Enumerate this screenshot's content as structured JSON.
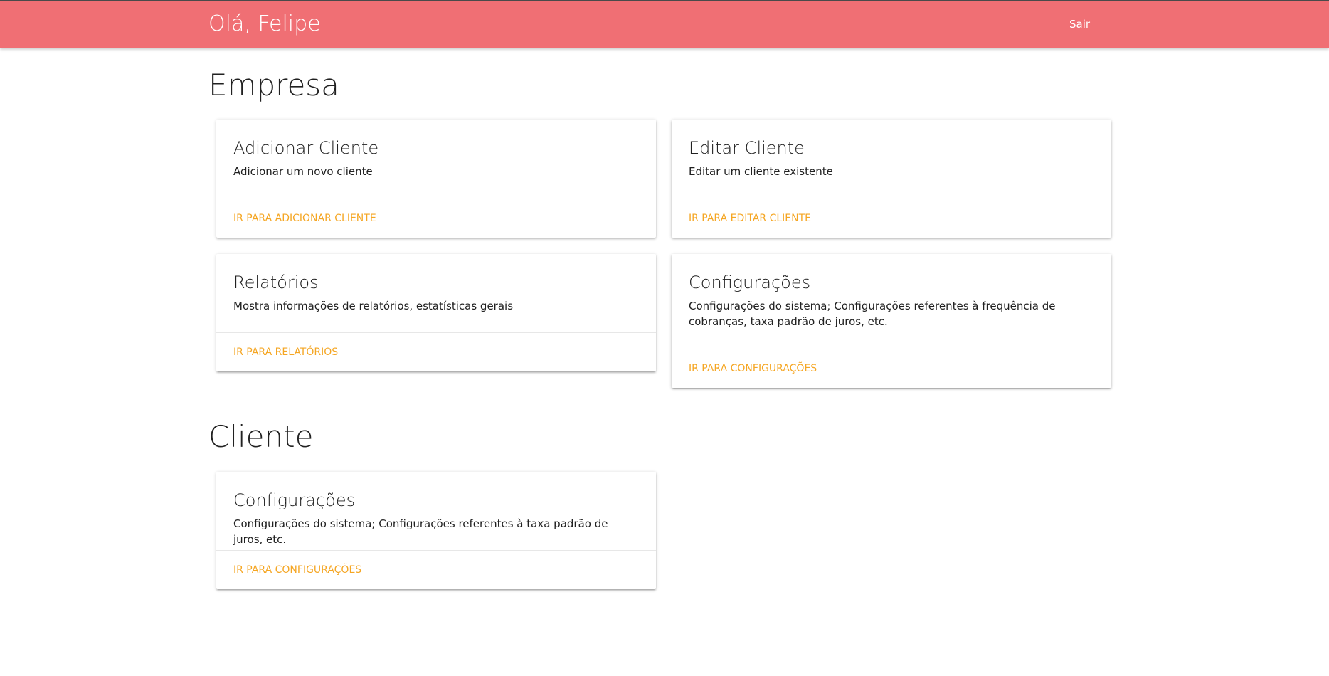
{
  "header": {
    "greeting": "Olá, Felipe",
    "logout_label": "Sair"
  },
  "sections": {
    "empresa": {
      "title": "Empresa",
      "cards": {
        "add_client": {
          "title": "Adicionar Cliente",
          "description": "Adicionar um novo cliente",
          "link": "IR PARA ADICIONAR CLIENTE"
        },
        "edit_client": {
          "title": "Editar Cliente",
          "description": "Editar um cliente existente",
          "link": "IR PARA EDITAR CLIENTE"
        },
        "reports": {
          "title": "Relatórios",
          "description": "Mostra informações de relatórios, estatísticas gerais",
          "link": "IR PARA RELATÓRIOS"
        },
        "settings": {
          "title": "Configurações",
          "description": "Configurações do sistema; Configurações referentes à frequência de cobranças, taxa padrão de juros, etc.",
          "link": "IR PARA CONFIGURAÇÕES"
        }
      }
    },
    "cliente": {
      "title": "Cliente",
      "cards": {
        "settings": {
          "title": "Configurações",
          "description": "Configurações do sistema; Configurações referentes à taxa padrão de juros, etc.",
          "link": "IR PARA CONFIGURAÇÕES"
        }
      }
    }
  },
  "colors": {
    "header_bg": "#f06f74",
    "link": "#f5a623"
  }
}
